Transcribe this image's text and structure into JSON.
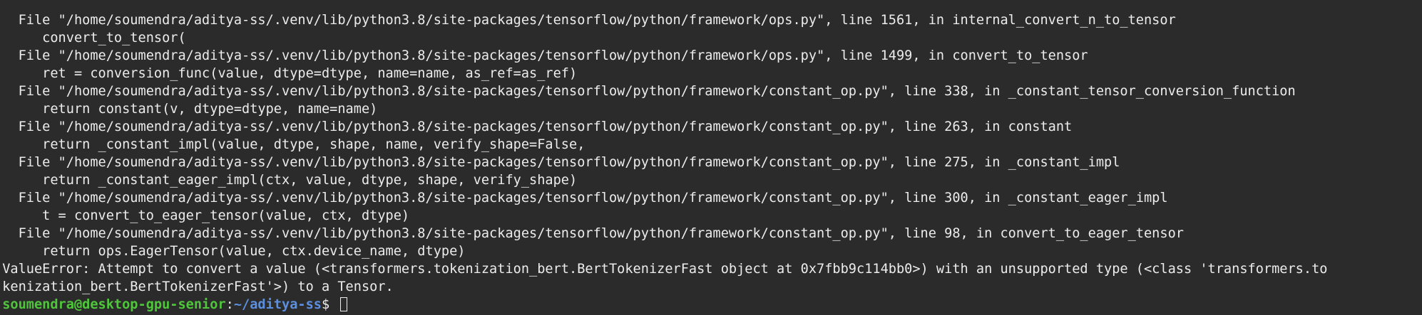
{
  "terminal": {
    "lines": [
      "   File \"/home/soumendra/aditya-ss/.venv/lib/python3.8/site-packages/tensorflow/python/framework/ops.py\", line 1561, in internal_convert_n_to_tensor",
      "      convert_to_tensor(",
      "   File \"/home/soumendra/aditya-ss/.venv/lib/python3.8/site-packages/tensorflow/python/framework/ops.py\", line 1499, in convert_to_tensor",
      "      ret = conversion_func(value, dtype=dtype, name=name, as_ref=as_ref)",
      "   File \"/home/soumendra/aditya-ss/.venv/lib/python3.8/site-packages/tensorflow/python/framework/constant_op.py\", line 338, in _constant_tensor_conversion_function",
      "      return constant(v, dtype=dtype, name=name)",
      "   File \"/home/soumendra/aditya-ss/.venv/lib/python3.8/site-packages/tensorflow/python/framework/constant_op.py\", line 263, in constant",
      "      return _constant_impl(value, dtype, shape, name, verify_shape=False,",
      "   File \"/home/soumendra/aditya-ss/.venv/lib/python3.8/site-packages/tensorflow/python/framework/constant_op.py\", line 275, in _constant_impl",
      "      return _constant_eager_impl(ctx, value, dtype, shape, verify_shape)",
      "   File \"/home/soumendra/aditya-ss/.venv/lib/python3.8/site-packages/tensorflow/python/framework/constant_op.py\", line 300, in _constant_eager_impl",
      "      t = convert_to_eager_tensor(value, ctx, dtype)",
      "   File \"/home/soumendra/aditya-ss/.venv/lib/python3.8/site-packages/tensorflow/python/framework/constant_op.py\", line 98, in convert_to_eager_tensor",
      "      return ops.EagerTensor(value, ctx.device_name, dtype)",
      " ValueError: Attempt to convert a value (<transformers.tokenization_bert.BertTokenizerFast object at 0x7fbb9c114bb0>) with an unsupported type (<class 'transformers.to",
      " kenization_bert.BertTokenizerFast'>) to a Tensor."
    ],
    "prompt": {
      "user_host": " soumendra@desktop-gpu-senior",
      "colon": ":",
      "path": "~/aditya-ss",
      "dollar": "$ "
    }
  },
  "colors": {
    "background": "#2b2b2b",
    "text": "#ececec",
    "prompt_user": "#4ec73a",
    "prompt_path": "#5b8fe0"
  }
}
